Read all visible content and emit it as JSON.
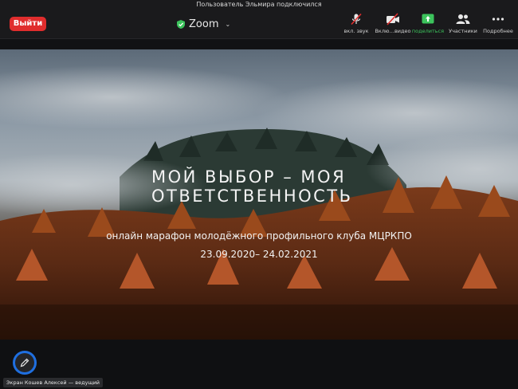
{
  "notification": "Пользователь Эльмира подключился",
  "topbar": {
    "leave_label": "Выйти",
    "app_title": "Zoom",
    "tools": [
      {
        "label": "вкл. звук",
        "icon": "mic-muted-icon"
      },
      {
        "label": "Вклю…видео",
        "icon": "video-off-icon"
      },
      {
        "label": "поделиться",
        "icon": "share-screen-icon"
      },
      {
        "label": "Участники",
        "icon": "participants-icon"
      },
      {
        "label": "Подробнее",
        "icon": "more-icon"
      }
    ]
  },
  "slide": {
    "title_line1": "МОЙ ВЫБОР – МОЯ",
    "title_line2": "ОТВЕТСТВЕННОСТЬ",
    "subtitle": "онлайн марафон молодёжного профильного клуба МЦРКПО",
    "dates": "23.09.2020– 24.02.2021"
  },
  "presenter_label": "Экран Кошев Алексей — ведущий",
  "colors": {
    "leave": "#e02d2d",
    "share": "#3cc35c",
    "annotate": "#1f6fe0"
  }
}
